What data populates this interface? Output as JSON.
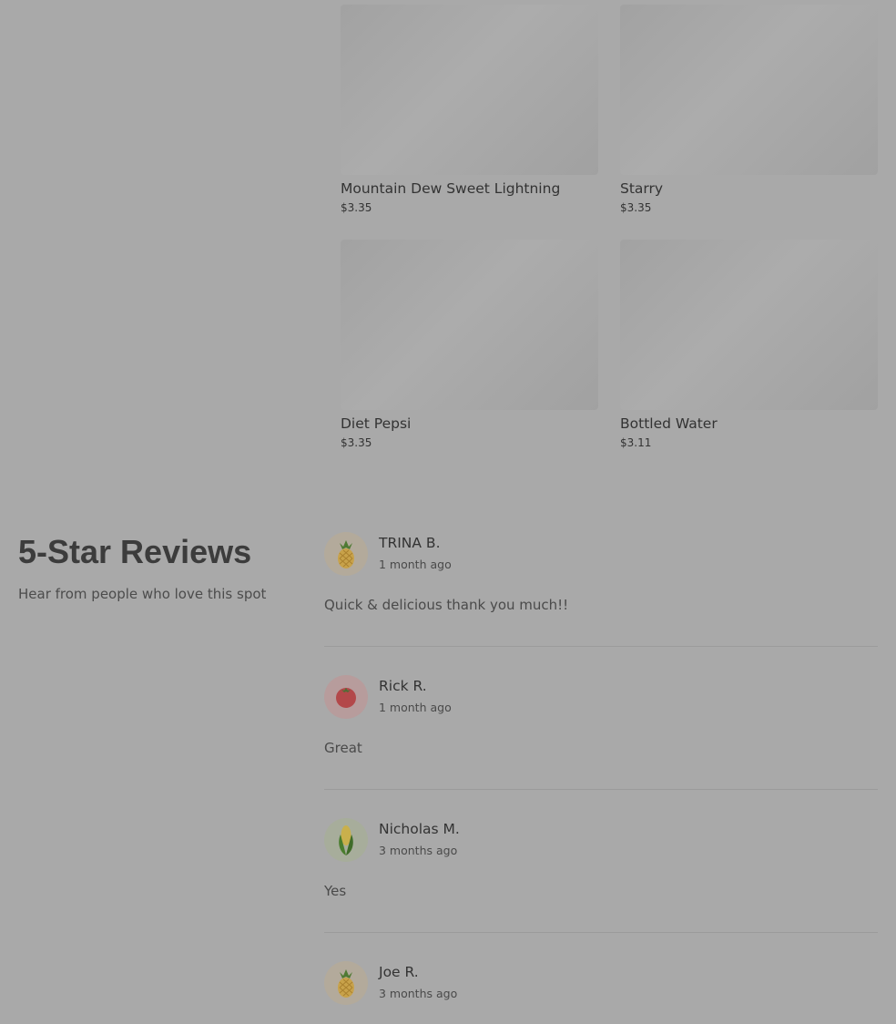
{
  "products": [
    {
      "name": "Mountain Dew Sweet Lightning",
      "price": "$3.35"
    },
    {
      "name": "Starry",
      "price": "$3.35"
    },
    {
      "name": "Diet Pepsi",
      "price": "$3.35"
    },
    {
      "name": "Bottled Water",
      "price": "$3.11"
    }
  ],
  "reviews_section": {
    "title": "5-Star Reviews",
    "subtitle": "Hear from people who love this spot"
  },
  "reviews": [
    {
      "name": "TRINA B.",
      "time": "1 month ago",
      "text": "Quick & delicious thank you much!!",
      "avatar_icon": "pineapple-icon"
    },
    {
      "name": "Rick R.",
      "time": "1 month ago",
      "text": "Great",
      "avatar_icon": "tomato-icon"
    },
    {
      "name": "Nicholas M.",
      "time": "3 months ago",
      "text": "Yes",
      "avatar_icon": "corn-icon"
    },
    {
      "name": "Joe R.",
      "time": "3 months ago",
      "text": "",
      "avatar_icon": "pineapple-icon"
    }
  ],
  "colors": {
    "overlay_background": "#a9a9a9",
    "avatar_pineapple_bg": "#b3aa9b",
    "avatar_tomato_bg": "#b79c9c",
    "avatar_corn_bg": "#a7ad9b"
  }
}
